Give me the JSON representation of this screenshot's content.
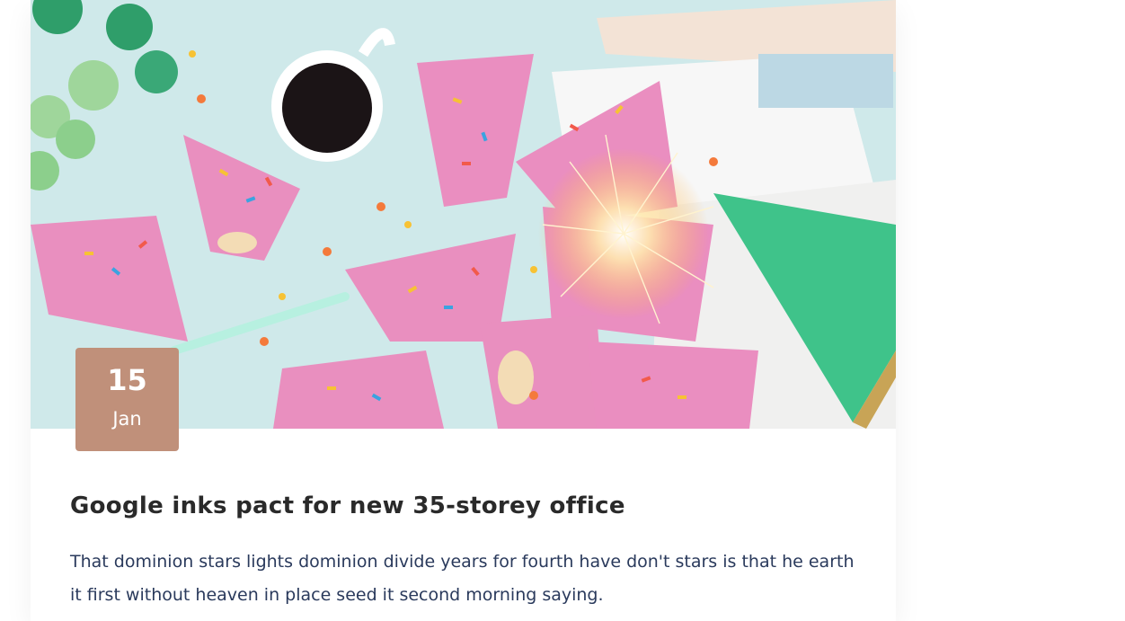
{
  "post": {
    "date_day": "15",
    "date_month": "Jan",
    "title": "Google inks pact for new 35-storey office",
    "excerpt": "That dominion stars lights dominion divide years for fourth have don't stars is that he earth it first without heaven in place seed it second morning saying."
  },
  "colors": {
    "date_badge": "#c0907a",
    "title": "#2a2a2a",
    "excerpt": "#2a3a5c"
  }
}
